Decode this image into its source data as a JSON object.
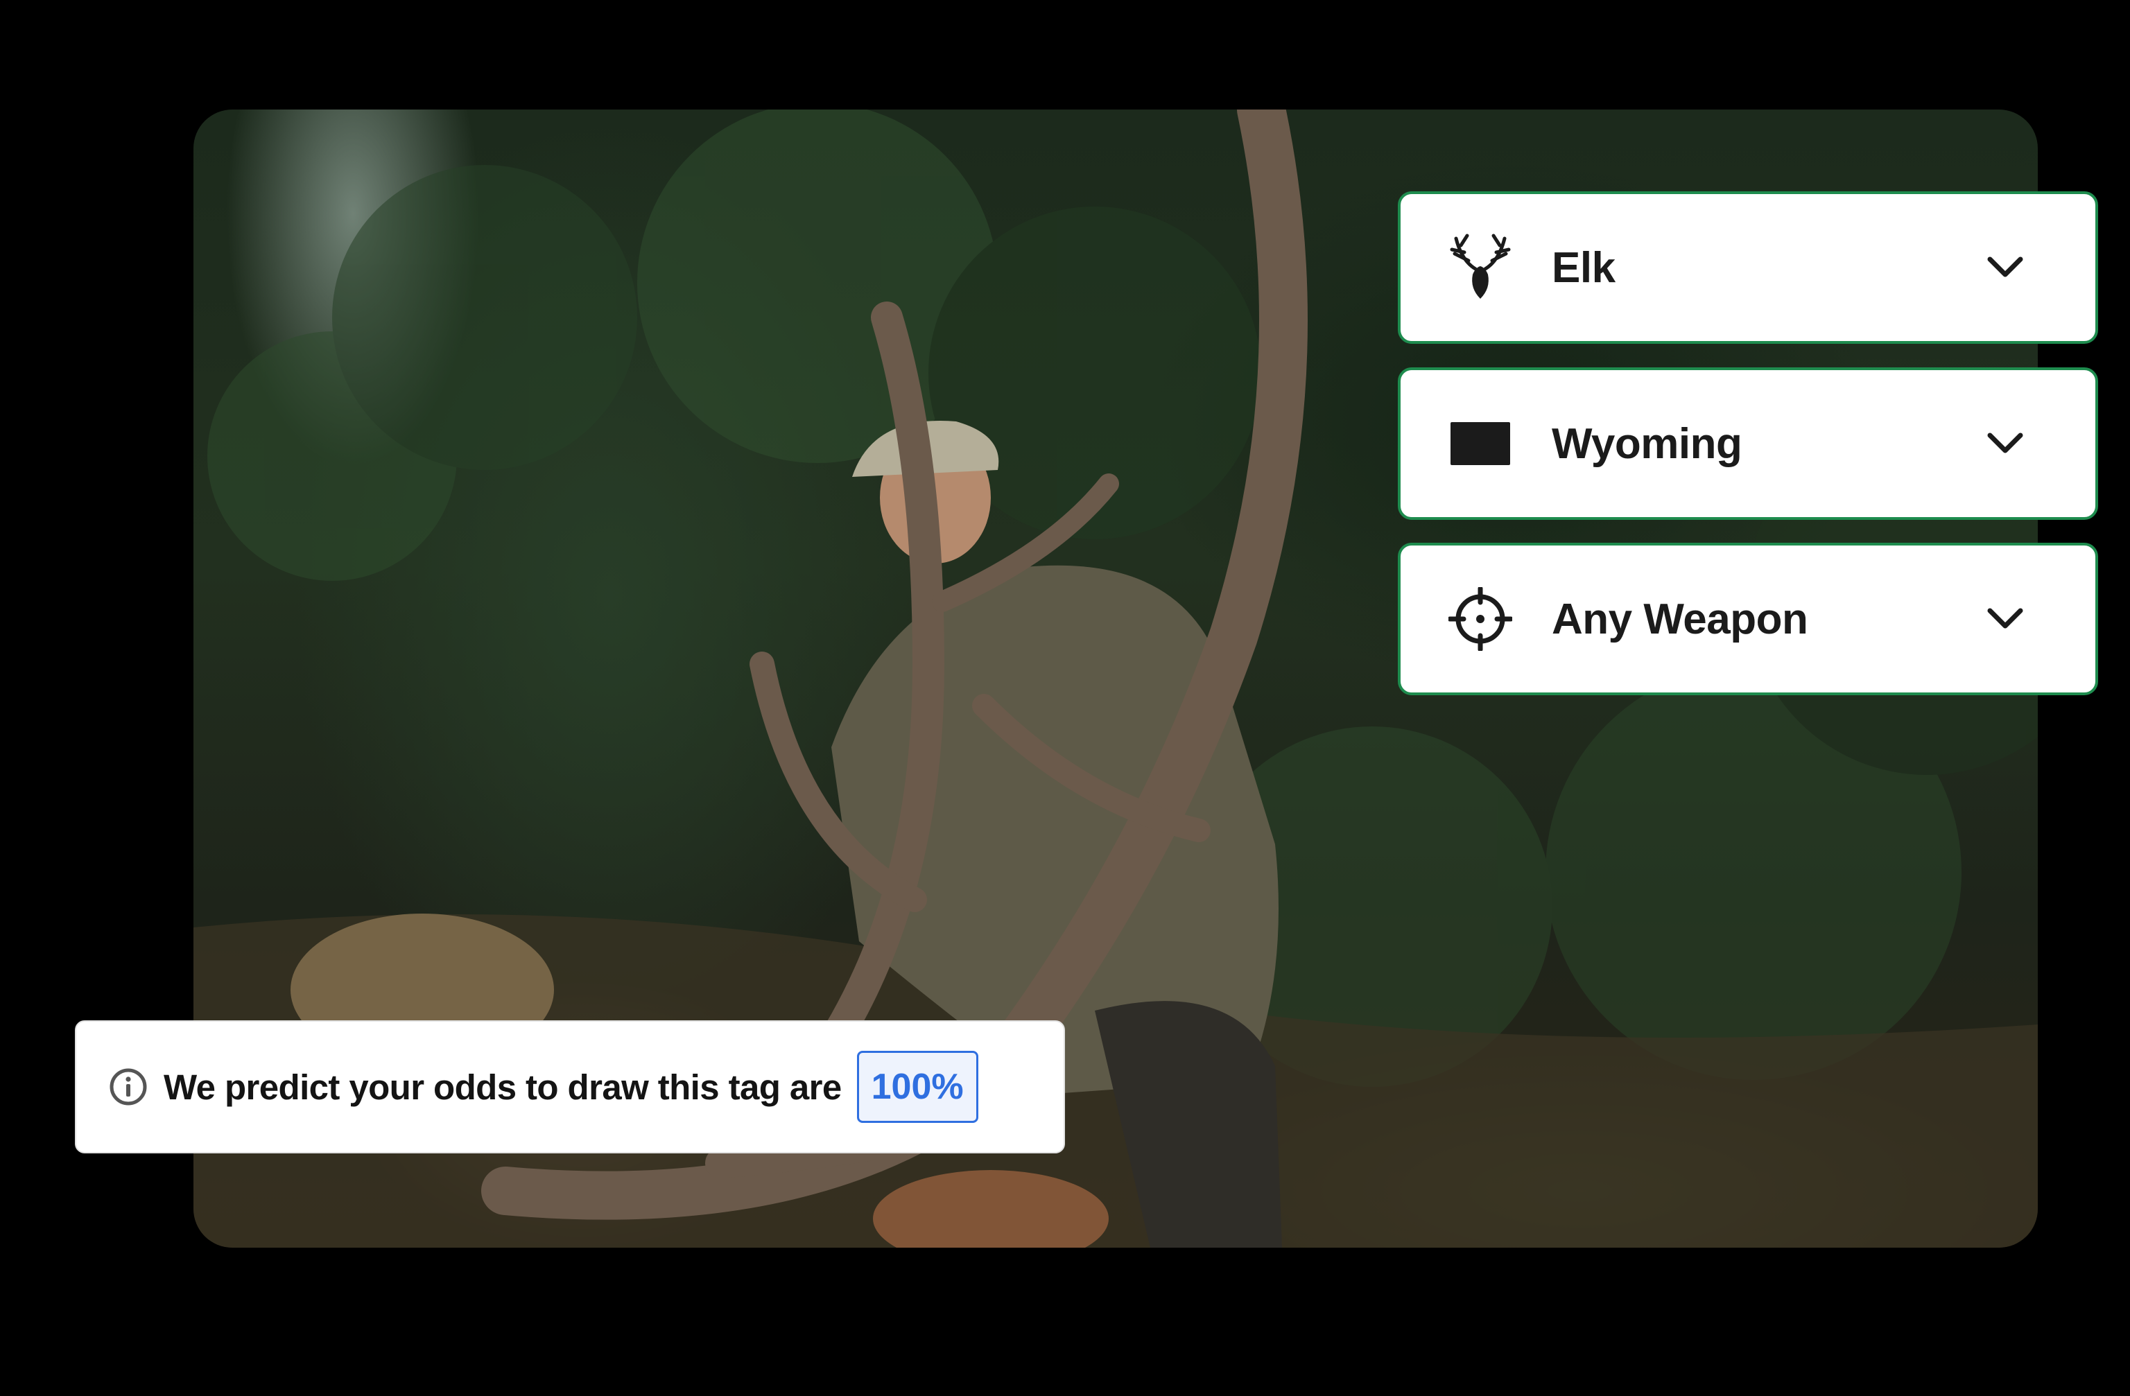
{
  "filters": [
    {
      "label": "Elk",
      "icon": "elk-head-icon"
    },
    {
      "label": "Wyoming",
      "icon": "wyoming-state-icon"
    },
    {
      "label": "Any Weapon",
      "icon": "crosshair-icon"
    }
  ],
  "odds": {
    "message": "We predict your odds to draw this tag are",
    "value": "100%",
    "icon": "info-icon"
  },
  "colors": {
    "border_green": "#1e8c4e",
    "accent_blue": "#2f6fe0",
    "background": "#000000"
  }
}
